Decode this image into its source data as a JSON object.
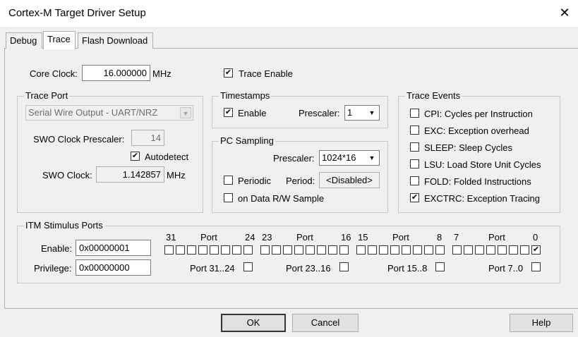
{
  "window": {
    "title": "Cortex-M Target Driver Setup",
    "close_glyph": "✕"
  },
  "tabs": [
    {
      "label": "Debug",
      "active": false
    },
    {
      "label": "Trace",
      "active": true
    },
    {
      "label": "Flash Download",
      "active": false
    }
  ],
  "core_clock": {
    "label": "Core Clock:",
    "value": "16.000000",
    "unit": "MHz"
  },
  "trace_enable": {
    "label": "Trace Enable",
    "checked": true
  },
  "trace_port": {
    "title": "Trace Port",
    "mode": "Serial Wire Output - UART/NRZ",
    "swo_prescaler_label": "SWO Clock Prescaler:",
    "swo_prescaler_value": "14",
    "autodetect_label": "Autodetect",
    "autodetect_checked": true,
    "swo_clock_label": "SWO Clock:",
    "swo_clock_value": "1.142857",
    "swo_clock_unit": "MHz"
  },
  "timestamps": {
    "title": "Timestamps",
    "enable_label": "Enable",
    "enable_checked": true,
    "prescaler_label": "Prescaler:",
    "prescaler_value": "1"
  },
  "pc_sampling": {
    "title": "PC Sampling",
    "prescaler_label": "Prescaler:",
    "prescaler_value": "1024*16",
    "periodic_label": "Periodic",
    "periodic_checked": false,
    "period_label": "Period:",
    "period_value": "<Disabled>",
    "on_data_label": "on Data R/W Sample",
    "on_data_checked": false
  },
  "trace_events": {
    "title": "Trace Events",
    "items": [
      {
        "label": "CPI: Cycles per Instruction",
        "checked": false
      },
      {
        "label": "EXC: Exception overhead",
        "checked": false
      },
      {
        "label": "SLEEP: Sleep Cycles",
        "checked": false
      },
      {
        "label": "LSU: Load Store Unit Cycles",
        "checked": false
      },
      {
        "label": "FOLD: Folded Instructions",
        "checked": false
      },
      {
        "label": "EXCTRC: Exception Tracing",
        "checked": true
      }
    ]
  },
  "itm": {
    "title": "ITM Stimulus Ports",
    "enable_label": "Enable:",
    "enable_value": "0x00000001",
    "privilege_label": "Privilege:",
    "privilege_value": "0x00000000",
    "groups": [
      {
        "hi": "31",
        "port": "Port",
        "lo": "24",
        "priv_label": "Port 31..24",
        "priv_checked": false
      },
      {
        "hi": "23",
        "port": "Port",
        "lo": "16",
        "priv_label": "Port 23..16",
        "priv_checked": false
      },
      {
        "hi": "15",
        "port": "Port",
        "lo": "8",
        "priv_label": "Port 15..8",
        "priv_checked": false
      },
      {
        "hi": "7",
        "port": "Port",
        "lo": "0",
        "priv_label": "Port 7..0",
        "priv_checked": false
      }
    ],
    "port_enabled": [
      false,
      false,
      false,
      false,
      false,
      false,
      false,
      false,
      false,
      false,
      false,
      false,
      false,
      false,
      false,
      false,
      false,
      false,
      false,
      false,
      false,
      false,
      false,
      false,
      false,
      false,
      false,
      false,
      false,
      false,
      false,
      true
    ]
  },
  "buttons": {
    "ok": "OK",
    "cancel": "Cancel",
    "help": "Help"
  }
}
